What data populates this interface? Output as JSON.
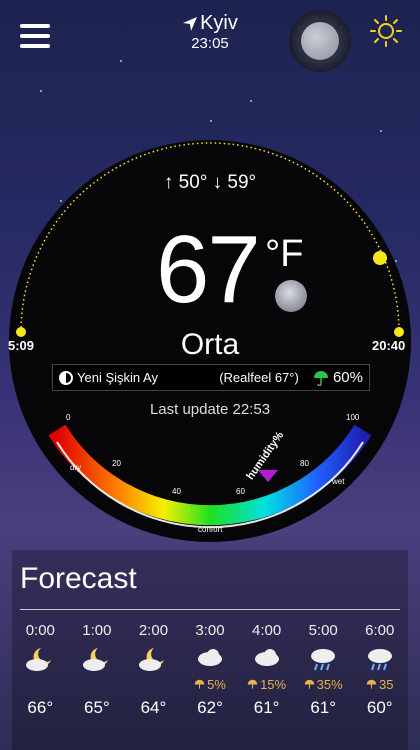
{
  "header": {
    "city": "Kyiv",
    "time": "23:05"
  },
  "icons": {
    "menu": "hamburger-menu-icon",
    "location": "location-arrow-icon",
    "moon_mode": "moon-toggle-icon",
    "sun_mode": "sun-toggle-icon"
  },
  "main": {
    "hi_lo": "↑ 50° ↓ 59°",
    "temperature": "67",
    "unit": "°F",
    "condition": "Orta",
    "sunrise": "5:09",
    "sunset": "20:40",
    "moon_phase": "Yeni Şişkin Ay",
    "realfeel": "(Realfeel 67°)",
    "precip_chance": "60%",
    "last_update": "Last update 22:53"
  },
  "humidity_gauge": {
    "label": "humidity%",
    "ticks": [
      "0",
      "20",
      "40",
      "60",
      "80",
      "100"
    ],
    "zones": [
      "dry",
      "confort",
      "wet"
    ],
    "value_percent": 67
  },
  "forecast": {
    "title": "Forecast",
    "hours": [
      {
        "time": "0:00",
        "icon": "moon-cloud-icon",
        "prob": "",
        "temp": "66°"
      },
      {
        "time": "1:00",
        "icon": "moon-cloud-icon",
        "prob": "",
        "temp": "65°"
      },
      {
        "time": "2:00",
        "icon": "moon-cloud-icon",
        "prob": "",
        "temp": "64°"
      },
      {
        "time": "3:00",
        "icon": "cloud-icon",
        "prob": "5%",
        "temp": "62°"
      },
      {
        "time": "4:00",
        "icon": "cloud-icon",
        "prob": "15%",
        "temp": "61°"
      },
      {
        "time": "5:00",
        "icon": "rain-cloud-icon",
        "prob": "35%",
        "temp": "61°"
      },
      {
        "time": "6:00",
        "icon": "rain-cloud-icon",
        "prob": "35",
        "temp": "60°"
      }
    ]
  },
  "colors": {
    "accent_yellow": "#f5e71c",
    "prob_orange": "#e6b24b",
    "umbrella_green": "#2ec24a",
    "pointer_purple": "#b01fd6"
  }
}
